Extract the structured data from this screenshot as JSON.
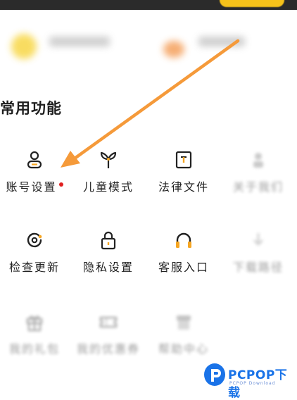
{
  "section": {
    "title": "常用功能"
  },
  "functions": [
    {
      "label": "账号设置",
      "icon": "user-icon",
      "badge": true
    },
    {
      "label": "儿童模式",
      "icon": "sprout-icon"
    },
    {
      "label": "法律文件",
      "icon": "document-icon"
    },
    {
      "label": "关于我们",
      "icon": "info-icon",
      "faded": true
    },
    {
      "label": "检查更新",
      "icon": "refresh-icon"
    },
    {
      "label": "隐私设置",
      "icon": "lock-icon"
    },
    {
      "label": "客服入口",
      "icon": "headset-icon"
    },
    {
      "label": "下载路径",
      "icon": "download-icon",
      "faded": true
    },
    {
      "label": "我的礼包",
      "icon": "gift-icon",
      "faded": true
    },
    {
      "label": "我的优惠券",
      "icon": "coupon-icon",
      "faded": true
    },
    {
      "label": "帮助中心",
      "icon": "store-icon",
      "faded": true
    }
  ],
  "watermark": {
    "brand": "PCPOP下载",
    "sub": "PCPOP Download"
  },
  "colors": {
    "accent": "#f6c21a",
    "arrow": "#f59a3a",
    "badge": "#e02020",
    "watermark": "#1a73e8"
  }
}
